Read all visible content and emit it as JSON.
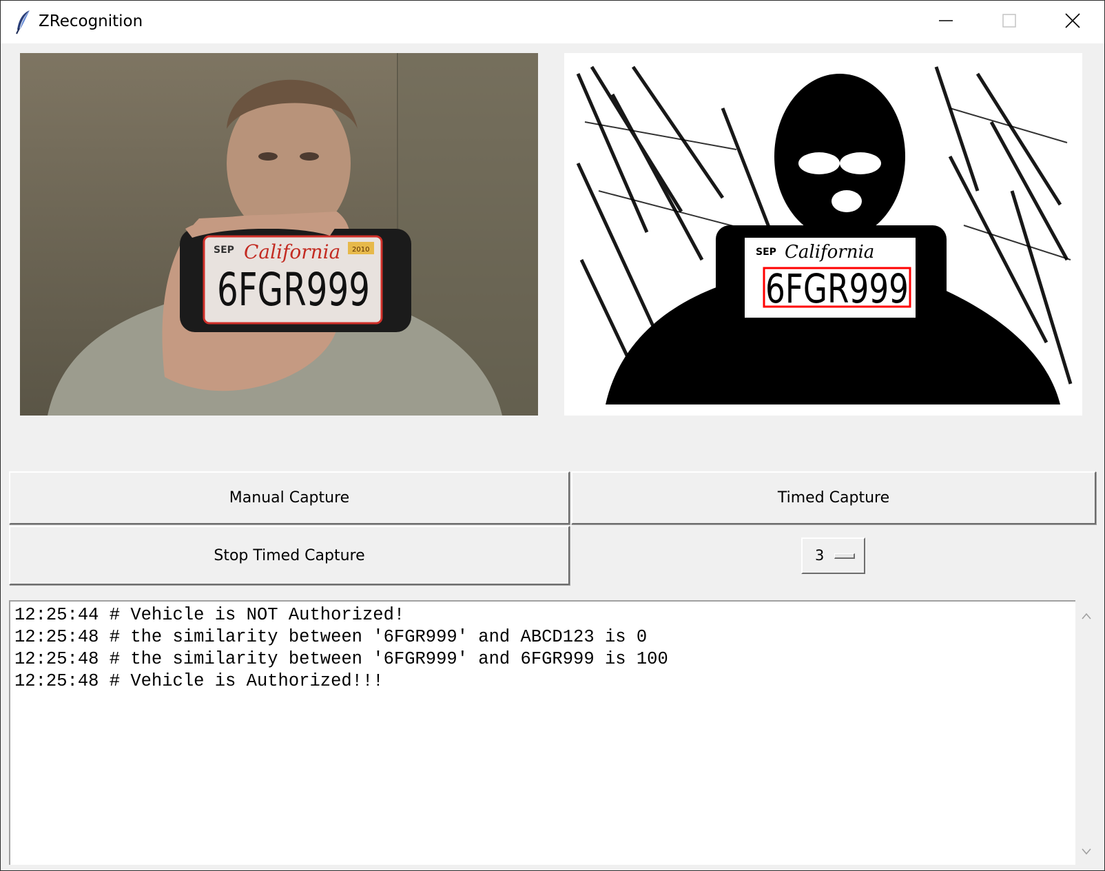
{
  "window": {
    "title": "ZRecognition",
    "icon": "feather-icon",
    "controls": [
      "minimize-icon",
      "maximize-icon",
      "close-icon"
    ]
  },
  "camera": {
    "original_view": "webcam-frame",
    "processed_view": "thresholded-frame",
    "plate_text": "6FGR999",
    "plate_state": "California",
    "plate_month": "SEP",
    "plate_year": "2010",
    "detection_box_color": "#ff0000"
  },
  "controls": {
    "manual_capture": "Manual Capture",
    "timed_capture": "Timed Capture",
    "stop_timed_capture": "Stop Timed Capture",
    "interval_value": "3"
  },
  "log": {
    "lines": [
      "12:25:44 # Vehicle is NOT Authorized!",
      "12:25:48 # the similarity between '6FGR999' and ABCD123 is 0",
      "12:25:48 # the similarity between '6FGR999' and 6FGR999 is 100",
      "12:25:48 # Vehicle is Authorized!!!"
    ]
  }
}
